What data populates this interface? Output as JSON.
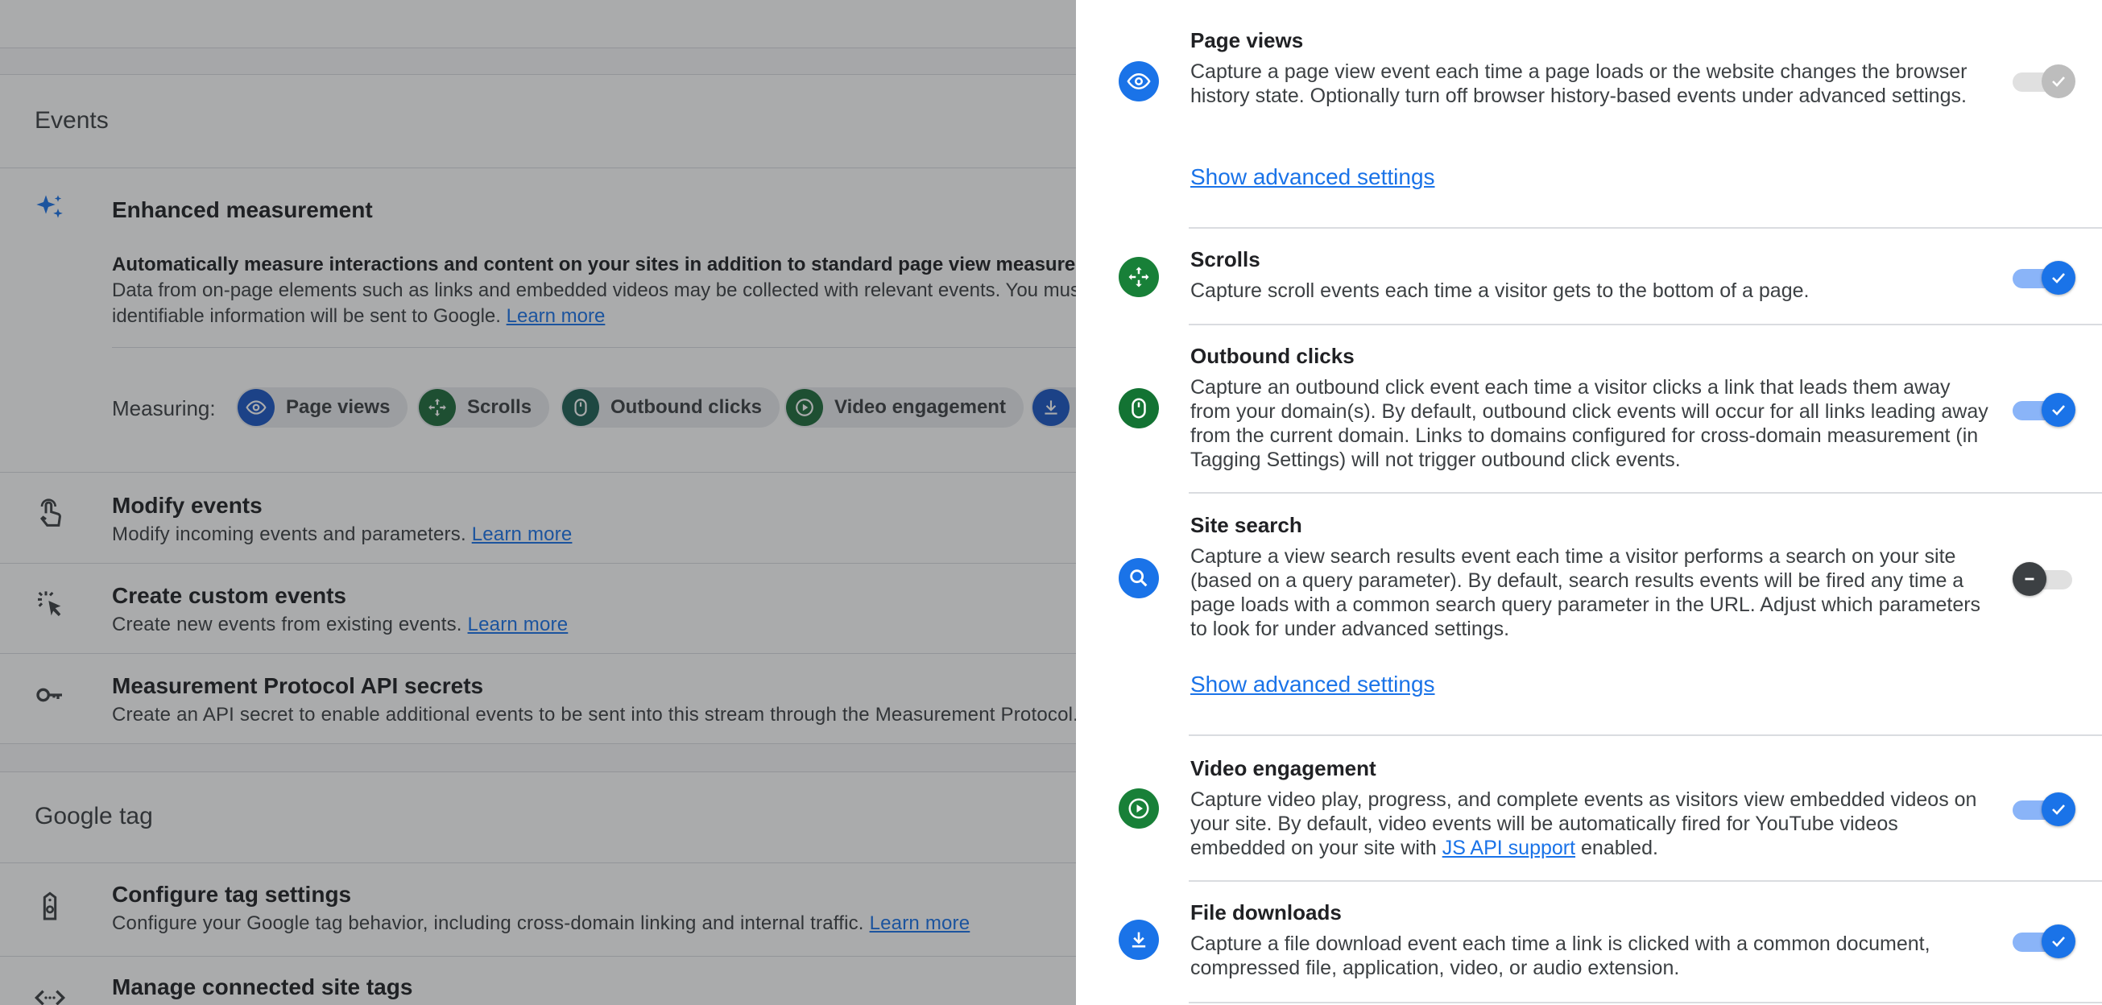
{
  "background": {
    "events": {
      "title": "Events",
      "enhanced_measurement": {
        "title": "Enhanced measurement",
        "desc_bold": "Automatically measure interactions and content on your sites in addition to standard page view measurement.",
        "desc_line2": "Data from on-page elements such as links and embedded videos may be collected with relevant events. You must ensure that no personally-",
        "desc_line3": "identifiable information will be sent to Google.",
        "learn_more": "Learn more",
        "measuring_label": "Measuring:",
        "chips": [
          "Page views",
          "Scrolls",
          "Outbound clicks",
          "Video engagement"
        ]
      },
      "modify_events": {
        "title": "Modify events",
        "desc": "Modify incoming events and parameters.",
        "learn_more": "Learn more"
      },
      "create_custom_events": {
        "title": "Create custom events",
        "desc": "Create new events from existing events.",
        "learn_more": "Learn more"
      },
      "measurement_protocol": {
        "title": "Measurement Protocol API secrets",
        "desc": "Create an API secret to enable additional events to be sent into this stream through the Measurement Protocol."
      }
    },
    "google_tag": {
      "title": "Google tag",
      "configure": {
        "title": "Configure tag settings",
        "desc": "Configure your Google tag behavior, including cross-domain linking and internal traffic.",
        "learn_more": "Learn more"
      },
      "manage": {
        "title": "Manage connected site tags"
      }
    }
  },
  "panel": {
    "page_views": {
      "title": "Page views",
      "desc": "Capture a page view event each time a page loads or the website changes the browser history state. Optionally turn off browser history-based events under advanced settings.",
      "advanced": "Show advanced settings",
      "toggle_state": "on-disabled"
    },
    "scrolls": {
      "title": "Scrolls",
      "desc": "Capture scroll events each time a visitor gets to the bottom of a page.",
      "toggle_state": "on"
    },
    "outbound_clicks": {
      "title": "Outbound clicks",
      "desc": "Capture an outbound click event each time a visitor clicks a link that leads them away from your domain(s). By default, outbound click events will occur for all links leading away from the current domain. Links to domains configured for cross-domain measurement (in Tagging Settings) will not trigger outbound click events.",
      "toggle_state": "on"
    },
    "site_search": {
      "title": "Site search",
      "desc": "Capture a view search results event each time a visitor performs a search on your site (based on a query parameter). By default, search results events will be fired any time a page loads with a common search query parameter in the URL. Adjust which parameters to look for under advanced settings.",
      "advanced": "Show advanced settings",
      "toggle_state": "off"
    },
    "video_engagement": {
      "title": "Video engagement",
      "desc_before": "Capture video play, progress, and complete events as visitors view embedded videos on your site. By default, video events will be automatically fired for YouTube videos embedded on your site with ",
      "desc_link": "JS API support",
      "desc_after": " enabled.",
      "toggle_state": "on"
    },
    "file_downloads": {
      "title": "File downloads",
      "desc": "Capture a file download event each time a link is clicked with a common document, compressed file, application, video, or audio extension.",
      "toggle_state": "on"
    }
  },
  "colors": {
    "blue": "#1a73e8",
    "blue_dark": "#1a56c4",
    "green": "#188038",
    "green_dark": "#1e6b3a",
    "teal": "#137333"
  }
}
